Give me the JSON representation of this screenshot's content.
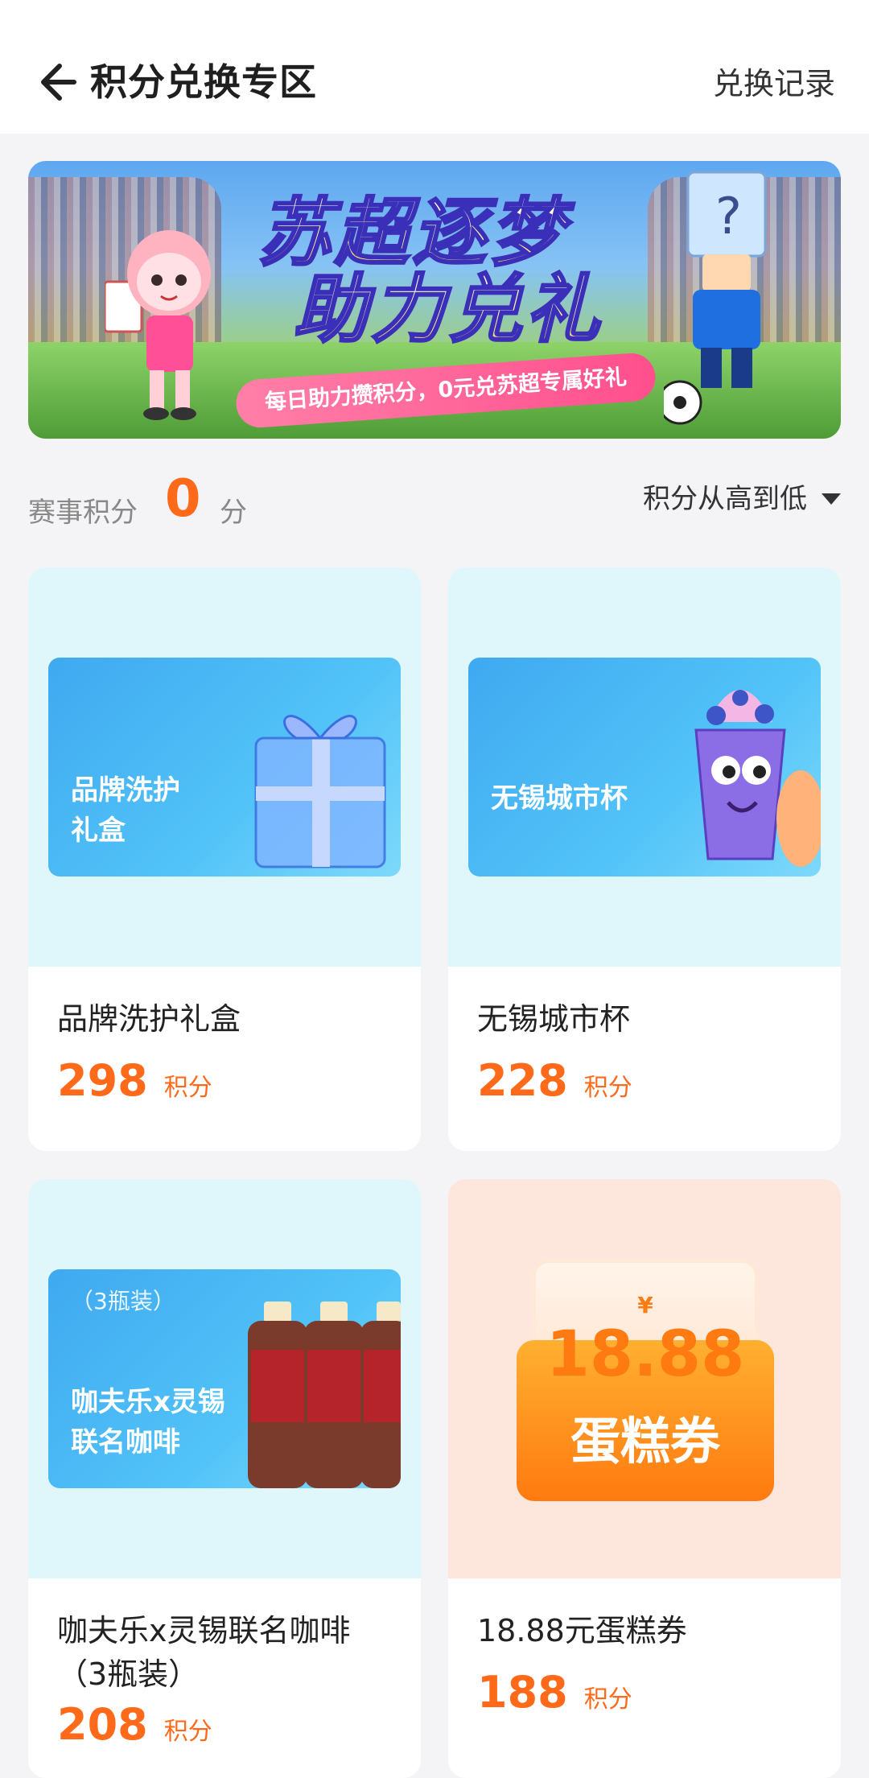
{
  "header": {
    "title": "积分兑换专区",
    "history_label": "兑换记录"
  },
  "banner": {
    "title_line1": "苏超逐梦",
    "title_line2": "助力兑礼",
    "subtitle": "每日助力攒积分，0元兑苏超专属好礼"
  },
  "points": {
    "label": "赛事积分",
    "value": "0",
    "unit": "分"
  },
  "sort": {
    "label": "积分从高到低"
  },
  "products": [
    {
      "image_text_line1": "品牌洗护",
      "image_text_line2": "礼盒",
      "name": "品牌洗护礼盒",
      "price": "298",
      "unit": "积分"
    },
    {
      "image_text_line1": "无锡城市杯",
      "name": "无锡城市杯",
      "price": "228",
      "unit": "积分"
    },
    {
      "image_small": "（3瓶装）",
      "image_text_line1": "咖夫乐x灵锡",
      "image_text_line2": "联名咖啡",
      "name_line1": "咖夫乐x灵锡联名咖啡",
      "name_line2": "（3瓶装）",
      "price": "208",
      "unit": "积分"
    },
    {
      "voucher_currency": "¥",
      "voucher_amount": "18.88",
      "voucher_label": "蛋糕券",
      "name": "18.88元蛋糕券",
      "price": "188",
      "unit": "积分"
    }
  ],
  "colors": {
    "accent": "#ff6a1a",
    "card_blue_bg": "#dff6fb",
    "card_peach_bg": "#fde6db"
  }
}
